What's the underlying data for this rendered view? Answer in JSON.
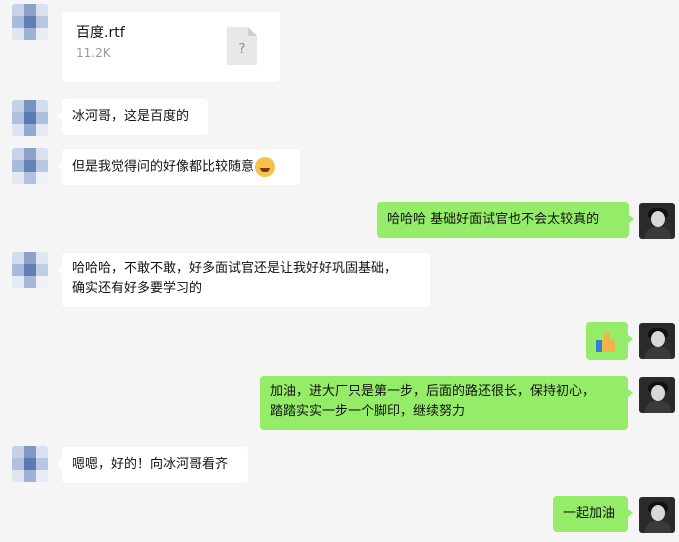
{
  "file_message": {
    "name": "百度.rtf",
    "size": "11.2K",
    "icon_glyph": "?"
  },
  "messages": {
    "m1": "冰河哥，这是百度的",
    "m2": "但是我觉得问的好像都比较随意",
    "m3": "哈哈哈  基础好面试官也不会太较真的",
    "m4_line1": "哈哈哈，不敢不敢，好多面试官还是让我好好巩固基础，",
    "m4_line2": "确实还有好多要学习的",
    "m6_line1": "加油，进大厂只是第一步，后面的路还很长，保持初心，",
    "m6_line2": "踏踏实实一步一个脚印，继续努力",
    "m7": "嗯嗯，好的！向冰河哥看齐",
    "m8": "一起加油"
  },
  "emojis": {
    "m2": "laughing-emoji",
    "m5": "thumbs-up-emoji"
  },
  "colors": {
    "background": "#f5f5f5",
    "incoming_bubble": "#ffffff",
    "outgoing_bubble": "#95ec69",
    "file_size_text": "#999999"
  }
}
